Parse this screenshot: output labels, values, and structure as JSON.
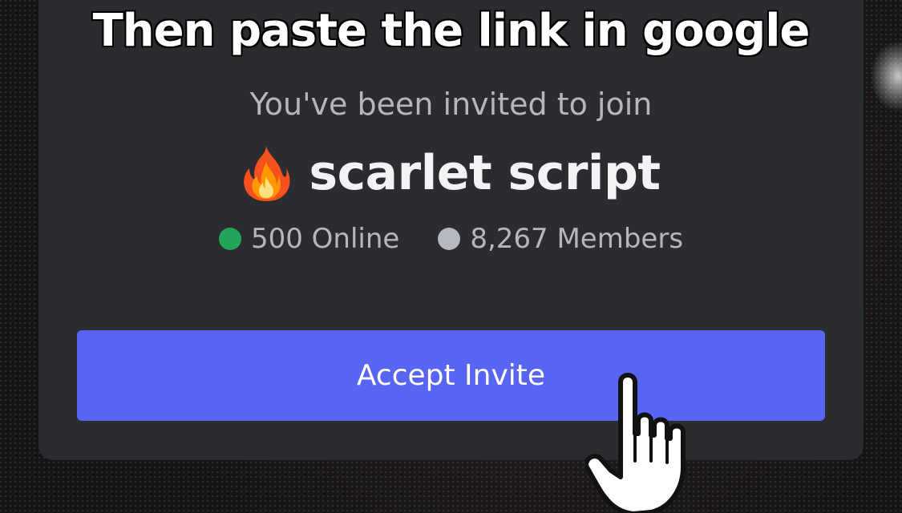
{
  "caption": "Then paste the link in google",
  "invite": {
    "intro": "You've been invited to join",
    "server_icon": "fire-emoji-icon",
    "server_name": "scarlet script",
    "online_text": "500 Online",
    "members_text": "8,267 Members",
    "accept_label": "Accept Invite"
  },
  "colors": {
    "accent": "#5865f2",
    "online": "#23a55a",
    "members": "#b5bac1",
    "modal_bg": "#2b2c30"
  }
}
